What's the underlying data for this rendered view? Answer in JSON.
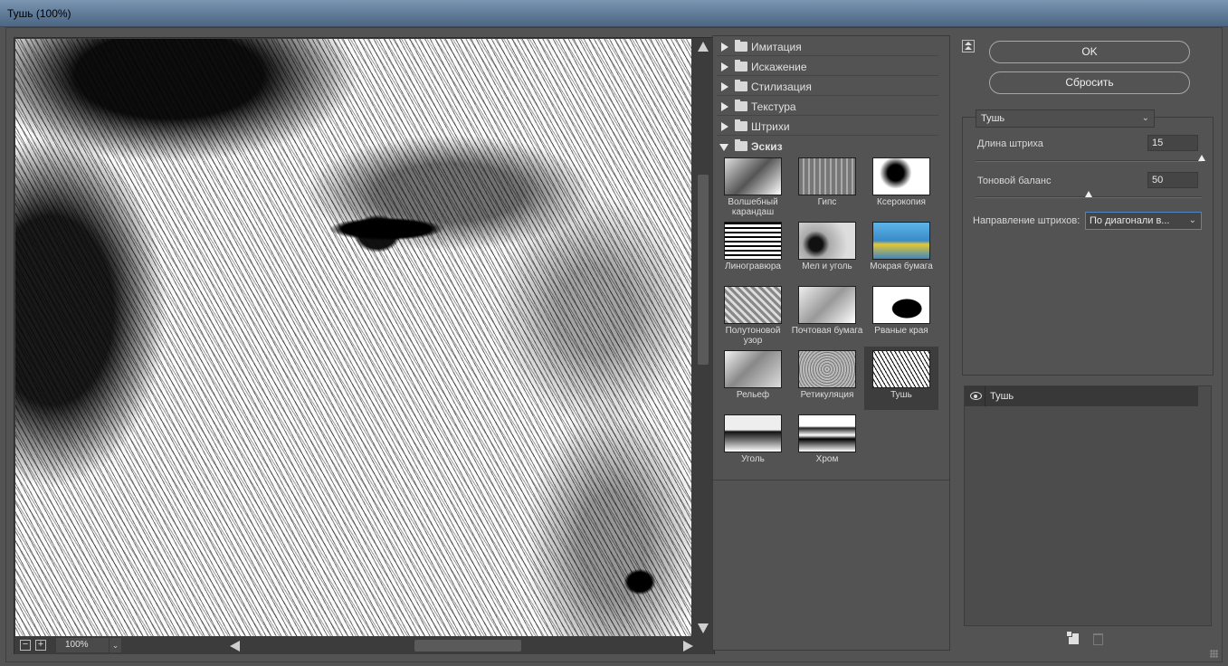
{
  "window": {
    "title": "Тушь (100%)"
  },
  "preview": {
    "zoom": "100%",
    "zoom_out": "−",
    "zoom_in": "+"
  },
  "gallery": {
    "categories": [
      {
        "label": "Имитация",
        "open": false
      },
      {
        "label": "Искажение",
        "open": false
      },
      {
        "label": "Стилизация",
        "open": false
      },
      {
        "label": "Текстура",
        "open": false
      },
      {
        "label": "Штрихи",
        "open": false
      },
      {
        "label": "Эскиз",
        "open": true
      }
    ],
    "filters": [
      {
        "name": "Волшебный карандаш",
        "selected": false
      },
      {
        "name": "Гипс",
        "selected": false
      },
      {
        "name": "Ксерокопия",
        "selected": false
      },
      {
        "name": "Линогравюра",
        "selected": false
      },
      {
        "name": "Мел и уголь",
        "selected": false
      },
      {
        "name": "Мокрая бумага",
        "selected": false
      },
      {
        "name": "Полутоновой узор",
        "selected": false
      },
      {
        "name": "Почтовая бумага",
        "selected": false
      },
      {
        "name": "Рваные края",
        "selected": false
      },
      {
        "name": "Рельеф",
        "selected": false
      },
      {
        "name": "Ретикуляция",
        "selected": false
      },
      {
        "name": "Тушь",
        "selected": true
      },
      {
        "name": "Уголь",
        "selected": false
      },
      {
        "name": "Хром",
        "selected": false
      }
    ]
  },
  "buttons": {
    "ok": "OK",
    "reset": "Сбросить"
  },
  "settings": {
    "filter_selected": "Тушь",
    "stroke_length_label": "Длина штриха",
    "stroke_length_value": "15",
    "stroke_length_level": 1.0,
    "tonal_balance_label": "Тоновой баланс",
    "tonal_balance_value": "50",
    "tonal_balance_level": 0.5,
    "direction_label": "Направление штрихов:",
    "direction_value": "По диагонали в..."
  },
  "layers": {
    "items": [
      {
        "name": "Тушь",
        "visible": true
      }
    ]
  },
  "colors": {
    "panel_bg": "#535353",
    "preview_bg": "#3c3c3c",
    "focus_border": "#4e87c6"
  }
}
